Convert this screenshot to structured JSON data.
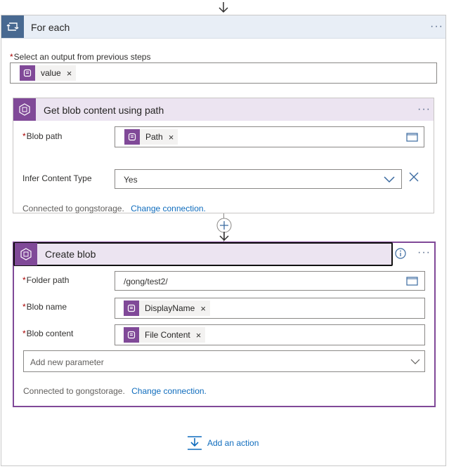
{
  "foreach": {
    "title": "For each",
    "menu": "···",
    "select_label": "Select an output from previous steps",
    "select_token": "value"
  },
  "get_blob": {
    "title": "Get blob content using path",
    "menu": "···",
    "blob_path_label": "Blob path",
    "blob_path_token": "Path",
    "infer_label": "Infer Content Type",
    "infer_value": "Yes",
    "connected_text": "Connected to gongstorage.",
    "change_connection": "Change connection."
  },
  "create_blob": {
    "title": "Create blob",
    "menu": "···",
    "folder_path_label": "Folder path",
    "folder_path_value": "/gong/test2/",
    "blob_name_label": "Blob name",
    "blob_name_token": "DisplayName",
    "blob_content_label": "Blob content",
    "blob_content_token": "File Content",
    "add_param_placeholder": "Add new parameter",
    "connected_text": "Connected to gongstorage.",
    "change_connection": "Change connection."
  },
  "add_action": "Add an action",
  "token_close": "×",
  "required_mark": "*",
  "colors": {
    "accent_purple": "#804998",
    "foreach_blue": "#486991",
    "link": "#0f6cbd"
  }
}
